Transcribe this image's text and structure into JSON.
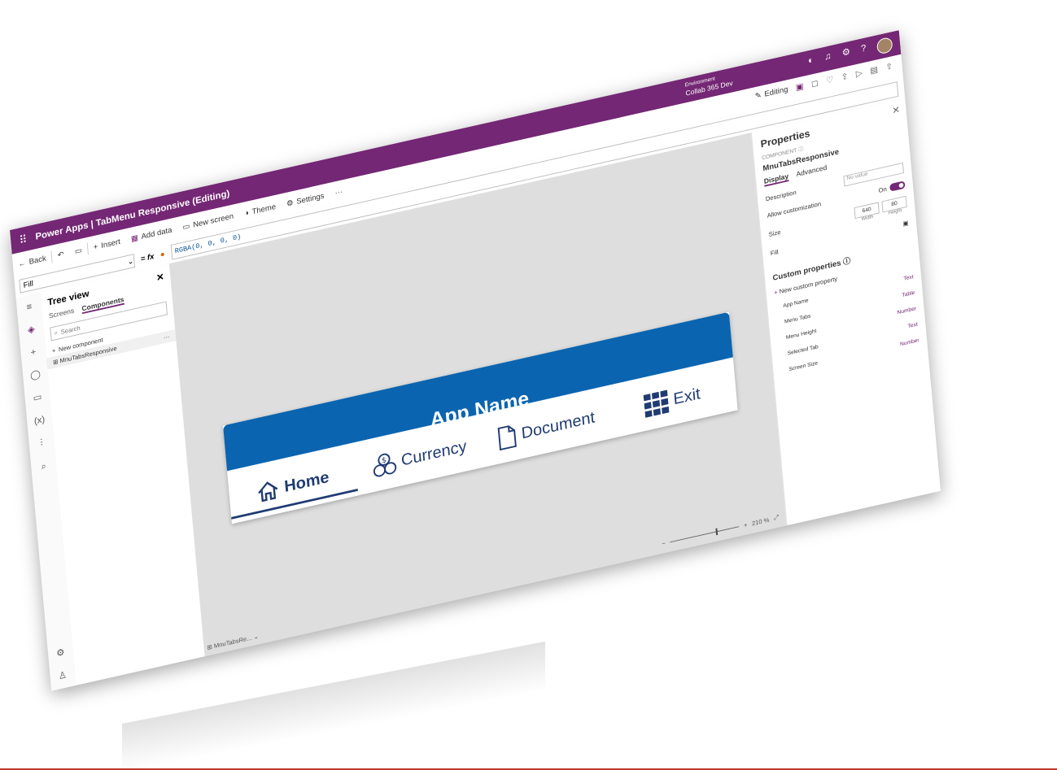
{
  "title": "Power Apps | TabMenu Responsive (Editing)",
  "environment": {
    "label": "Environment",
    "name": "Collab 365 Dev"
  },
  "commands": {
    "back": "Back",
    "insert": "Insert",
    "add_data": "Add data",
    "new_screen": "New screen",
    "theme": "Theme",
    "settings": "Settings",
    "more": "···",
    "editing": "Editing"
  },
  "formula": {
    "property": "Fill",
    "fx": "fx",
    "value": "RGBA(0, 0, 0, 0)"
  },
  "tree": {
    "title": "Tree view",
    "tab_screens": "Screens",
    "tab_components": "Components",
    "search_placeholder": "Search",
    "new_component": "New component",
    "item": "MnuTabsResponsive",
    "more": "···"
  },
  "component": {
    "app_name": "App Name",
    "tabs": [
      "Home",
      "Currency",
      "Document",
      "Exit"
    ]
  },
  "canvas": {
    "screen_label": "MnuTabsRe...",
    "zoom": "210 %"
  },
  "properties": {
    "title": "Properties",
    "component_label": "COMPONENT",
    "component_name": "MnuTabsResponsive",
    "tab_display": "Display",
    "tab_advanced": "Advanced",
    "description_label": "Description",
    "description_placeholder": "No value",
    "allow_customization_label": "Allow customization",
    "allow_customization_value": "On",
    "size_label": "Size",
    "width_value": "640",
    "width_label": "Width",
    "height_value": "80",
    "height_label": "Height",
    "fill_label": "Fill",
    "custom_title": "Custom properties",
    "new_custom": "New custom property",
    "custom_props": [
      {
        "name": "App Name",
        "type": "Text"
      },
      {
        "name": "Menu Tabs",
        "type": "Table"
      },
      {
        "name": "Menu Height",
        "type": "Number"
      },
      {
        "name": "Selected Tab",
        "type": "Text"
      },
      {
        "name": "Screen Size",
        "type": "Number"
      }
    ]
  },
  "colors": {
    "brand": "#742774",
    "header_bar": "#0b64b0",
    "tab_text": "#1f3b73"
  }
}
